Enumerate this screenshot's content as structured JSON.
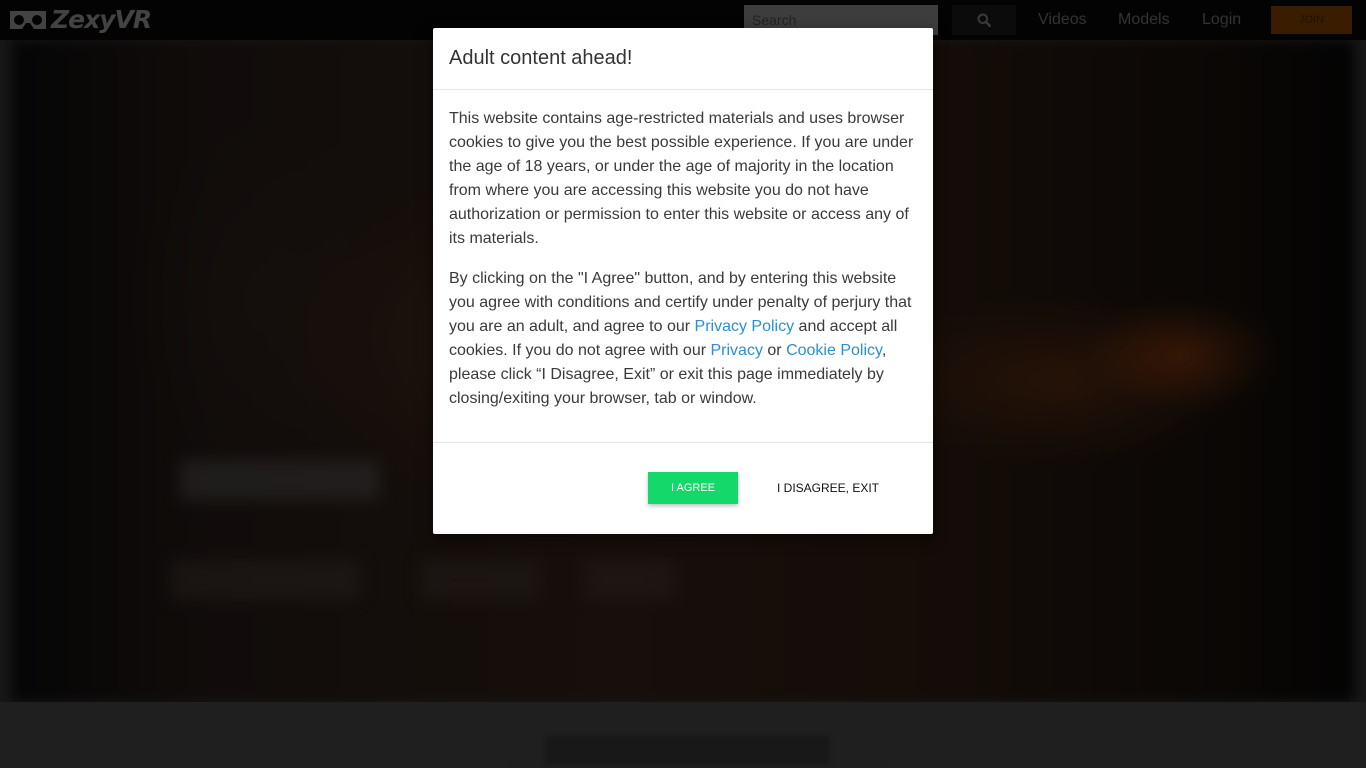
{
  "header": {
    "logo_text": "ZexyVR",
    "search_placeholder": "Search",
    "nav": [
      "Videos",
      "Models",
      "Login"
    ],
    "join_label": "JOIN",
    "colors": {
      "join_bg": "#6b3500",
      "header_bg": "#070707"
    }
  },
  "modal": {
    "title": "Adult content ahead!",
    "paragraph1": "This website contains age-restricted materials and uses browser cookies to give you the best possible experience. If you are under the age of 18 years, or under the age of majority in the location from where you are accessing this website you do not have authorization or permission to enter this website or access any of its materials.",
    "p2_part1": "By clicking on the \"I Agree\" button, and by entering this website you agree with conditions and certify under penalty of perjury that you are an adult, and agree to our ",
    "p2_link_privacy_policy": "Privacy Policy",
    "p2_part2": " and accept all cookies. If you do not agree with our ",
    "p2_link_privacy": "Privacy",
    "p2_part3": " or ",
    "p2_link_cookie_policy": "Cookie Policy",
    "p2_part4": ", please click “I Disagree, Exit” or exit this page immediately by closing/exiting your browser, tab or window.",
    "agree_label": "I AGREE",
    "disagree_label": "I DISAGREE, EXIT",
    "colors": {
      "agree_bg": "#14d869",
      "link": "#2a8fd6"
    }
  }
}
